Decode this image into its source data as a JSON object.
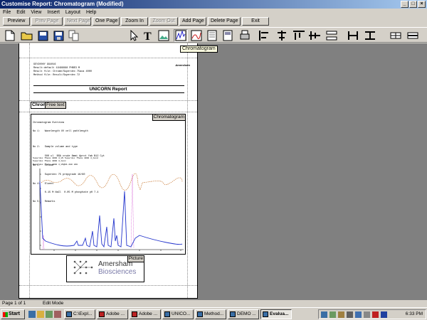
{
  "window": {
    "title": "Customise Report: Chromatogram (Modified)"
  },
  "menu": [
    "File",
    "Edit",
    "View",
    "Insert",
    "Layout",
    "Help"
  ],
  "commands": [
    {
      "label": "Preview",
      "enabled": true
    },
    {
      "label": "Prev Page",
      "enabled": false
    },
    {
      "label": "Next Page",
      "enabled": false
    },
    {
      "label": "One Page",
      "enabled": true
    },
    {
      "label": "Zoom In",
      "enabled": true
    },
    {
      "label": "Zoom Out",
      "enabled": false
    },
    {
      "label": "Add Page",
      "enabled": true
    },
    {
      "label": "Delete Page",
      "enabled": true
    },
    {
      "label": "Exit",
      "enabled": true
    }
  ],
  "tooltip": "Chromatogram",
  "report": {
    "logo_top": "Amersham",
    "header_lines": [
      "GSY2000Y 994016",
      "Result:default 19499998 PHBE3 M",
      "Result file: Chrome/Superdex 75aca 4000",
      "Method file: Result/Superdex 72"
    ],
    "title": "UNICORN Report",
    "chrom_object_label": "Chron",
    "free_text_label": "Free text",
    "chromatogram_label": "Chromatogram",
    "chrom_text_lines": [
      "Chromatogram Overview",
      "No 1:   Wavelength UV cell pathlength",
      "",
      "No 2:   Sample volume and type",
      "        500 ul  BSA crude 8mmi Aprot Yab B12 Cyt",
      "No 3:   Column",
      "        Superdex 75 prepgrade 16/60",
      "No 4:   Eluent",
      "        0.15 M NaCl  0.05 M phosphate pH 7.4",
      "No 5:   Remarks"
    ],
    "legend_lines": [
      "Superdex 75aca 4000 4_UV          Superdex 75aca 4000 4_Cond",
      "Superdex 75aca 4000 4_Conc",
      "Superdex 75aca 4000 4_UV@01.280 LDH"
    ],
    "picture_label": "Picture",
    "picture_text_1": "Amersham",
    "picture_text_2": "Biosciences"
  },
  "status": {
    "page": "Page 1 of 1",
    "mode": "Edit Mode"
  },
  "taskbar": {
    "start": "Start",
    "tasks": [
      "C:\\Expl...",
      "Adobe ...",
      "Adobe ...",
      "UNICO...",
      "Method...",
      "DEMO ...",
      "Evalua..."
    ],
    "active_task": "Evalua...",
    "clock": "6:33 PM"
  },
  "colors": {
    "title_start": "#0a246a",
    "uv": "#2233cc",
    "cond": "#c87832",
    "conc": "#cc33cc"
  }
}
